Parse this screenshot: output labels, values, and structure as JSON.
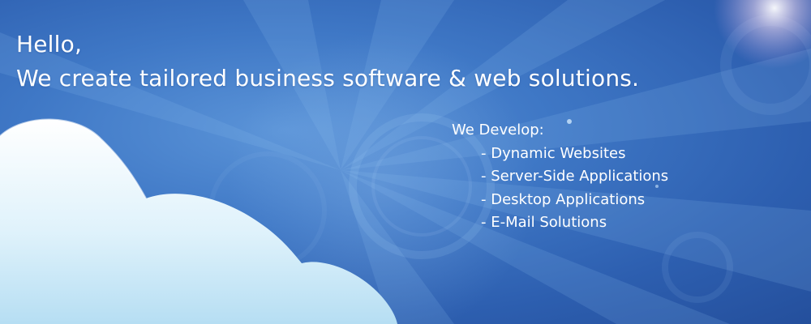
{
  "banner": {
    "greeting": "Hello,",
    "tagline": "We create tailored business software & web solutions."
  },
  "services": {
    "title": "We Develop:",
    "items": [
      "Dynamic Websites",
      "Server-Side Applications",
      "Desktop Applications",
      "E-Mail Solutions"
    ]
  },
  "colors": {
    "background": "#3f78c6",
    "text": "#ffffff",
    "cloud": "#e8f6fc"
  },
  "decorations": [
    "light-rays",
    "lens-flare",
    "cloud"
  ]
}
